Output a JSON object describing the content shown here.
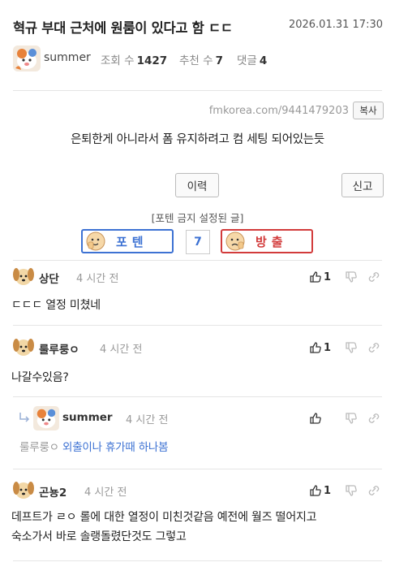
{
  "post": {
    "title": "혁규 부대 근처에 원룸이 있다고 함 ㄷㄷ",
    "date": "2026.01.31 17:30",
    "author": "summer",
    "views_label": "조회 수",
    "views": "1427",
    "recommend_label": "추천 수",
    "recommend": "7",
    "comments_label": "댓글",
    "comments": "4",
    "url": "fmkorea.com/9441479203",
    "copy_label": "복사",
    "content": "은퇴한게 아니라서 폼 유지하려고 컴 세팅 되어있는듯",
    "history_label": "이력",
    "report_label": "신고",
    "notice": "[포텐 금지 설정된 글]",
    "vote_up_label": "포텐",
    "vote_count": "7",
    "vote_down_label": "방출"
  },
  "comments": [
    {
      "name": "상단",
      "time": "4 시간 전",
      "likes": "1",
      "text": "ㄷㄷㄷ 열정 미쳤네"
    },
    {
      "name": "룰루룽ㅇ",
      "time": "4 시간 전",
      "likes": "1",
      "text": "나갈수있음?"
    },
    {
      "name": "summer",
      "time": "4 시간 전",
      "likes": "",
      "reply_to": "룰루룽ㅇ",
      "text": "외출이나 휴가때 하나봄"
    },
    {
      "name": "곤뇽2",
      "time": "4 시간 전",
      "likes": "1",
      "text_line1": "데프트가 ㄹㅇ 롤에 대한 열정이 미친것같음 예전에 월즈 떨어지고",
      "text_line2": "숙소가서 바로 솔랭돌렸단것도 그렇고"
    }
  ],
  "colors": {
    "accent_blue": "#3d72d3",
    "accent_red": "#d23b3b"
  }
}
